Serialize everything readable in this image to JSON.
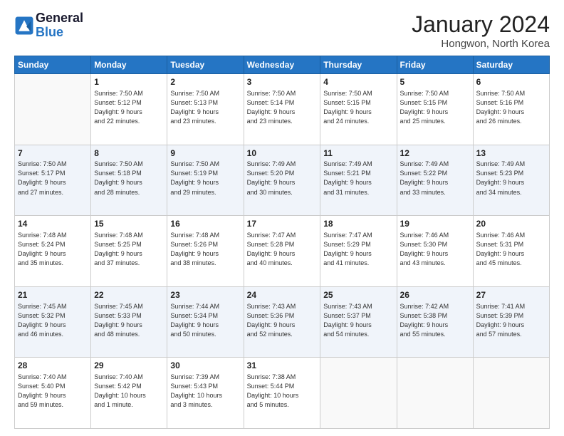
{
  "header": {
    "logo_line1": "General",
    "logo_line2": "Blue",
    "month": "January 2024",
    "location": "Hongwon, North Korea"
  },
  "days_of_week": [
    "Sunday",
    "Monday",
    "Tuesday",
    "Wednesday",
    "Thursday",
    "Friday",
    "Saturday"
  ],
  "weeks": [
    [
      {
        "num": "",
        "info": ""
      },
      {
        "num": "1",
        "info": "Sunrise: 7:50 AM\nSunset: 5:12 PM\nDaylight: 9 hours\nand 22 minutes."
      },
      {
        "num": "2",
        "info": "Sunrise: 7:50 AM\nSunset: 5:13 PM\nDaylight: 9 hours\nand 23 minutes."
      },
      {
        "num": "3",
        "info": "Sunrise: 7:50 AM\nSunset: 5:14 PM\nDaylight: 9 hours\nand 23 minutes."
      },
      {
        "num": "4",
        "info": "Sunrise: 7:50 AM\nSunset: 5:15 PM\nDaylight: 9 hours\nand 24 minutes."
      },
      {
        "num": "5",
        "info": "Sunrise: 7:50 AM\nSunset: 5:15 PM\nDaylight: 9 hours\nand 25 minutes."
      },
      {
        "num": "6",
        "info": "Sunrise: 7:50 AM\nSunset: 5:16 PM\nDaylight: 9 hours\nand 26 minutes."
      }
    ],
    [
      {
        "num": "7",
        "info": "Sunrise: 7:50 AM\nSunset: 5:17 PM\nDaylight: 9 hours\nand 27 minutes."
      },
      {
        "num": "8",
        "info": "Sunrise: 7:50 AM\nSunset: 5:18 PM\nDaylight: 9 hours\nand 28 minutes."
      },
      {
        "num": "9",
        "info": "Sunrise: 7:50 AM\nSunset: 5:19 PM\nDaylight: 9 hours\nand 29 minutes."
      },
      {
        "num": "10",
        "info": "Sunrise: 7:49 AM\nSunset: 5:20 PM\nDaylight: 9 hours\nand 30 minutes."
      },
      {
        "num": "11",
        "info": "Sunrise: 7:49 AM\nSunset: 5:21 PM\nDaylight: 9 hours\nand 31 minutes."
      },
      {
        "num": "12",
        "info": "Sunrise: 7:49 AM\nSunset: 5:22 PM\nDaylight: 9 hours\nand 33 minutes."
      },
      {
        "num": "13",
        "info": "Sunrise: 7:49 AM\nSunset: 5:23 PM\nDaylight: 9 hours\nand 34 minutes."
      }
    ],
    [
      {
        "num": "14",
        "info": "Sunrise: 7:48 AM\nSunset: 5:24 PM\nDaylight: 9 hours\nand 35 minutes."
      },
      {
        "num": "15",
        "info": "Sunrise: 7:48 AM\nSunset: 5:25 PM\nDaylight: 9 hours\nand 37 minutes."
      },
      {
        "num": "16",
        "info": "Sunrise: 7:48 AM\nSunset: 5:26 PM\nDaylight: 9 hours\nand 38 minutes."
      },
      {
        "num": "17",
        "info": "Sunrise: 7:47 AM\nSunset: 5:28 PM\nDaylight: 9 hours\nand 40 minutes."
      },
      {
        "num": "18",
        "info": "Sunrise: 7:47 AM\nSunset: 5:29 PM\nDaylight: 9 hours\nand 41 minutes."
      },
      {
        "num": "19",
        "info": "Sunrise: 7:46 AM\nSunset: 5:30 PM\nDaylight: 9 hours\nand 43 minutes."
      },
      {
        "num": "20",
        "info": "Sunrise: 7:46 AM\nSunset: 5:31 PM\nDaylight: 9 hours\nand 45 minutes."
      }
    ],
    [
      {
        "num": "21",
        "info": "Sunrise: 7:45 AM\nSunset: 5:32 PM\nDaylight: 9 hours\nand 46 minutes."
      },
      {
        "num": "22",
        "info": "Sunrise: 7:45 AM\nSunset: 5:33 PM\nDaylight: 9 hours\nand 48 minutes."
      },
      {
        "num": "23",
        "info": "Sunrise: 7:44 AM\nSunset: 5:34 PM\nDaylight: 9 hours\nand 50 minutes."
      },
      {
        "num": "24",
        "info": "Sunrise: 7:43 AM\nSunset: 5:36 PM\nDaylight: 9 hours\nand 52 minutes."
      },
      {
        "num": "25",
        "info": "Sunrise: 7:43 AM\nSunset: 5:37 PM\nDaylight: 9 hours\nand 54 minutes."
      },
      {
        "num": "26",
        "info": "Sunrise: 7:42 AM\nSunset: 5:38 PM\nDaylight: 9 hours\nand 55 minutes."
      },
      {
        "num": "27",
        "info": "Sunrise: 7:41 AM\nSunset: 5:39 PM\nDaylight: 9 hours\nand 57 minutes."
      }
    ],
    [
      {
        "num": "28",
        "info": "Sunrise: 7:40 AM\nSunset: 5:40 PM\nDaylight: 9 hours\nand 59 minutes."
      },
      {
        "num": "29",
        "info": "Sunrise: 7:40 AM\nSunset: 5:42 PM\nDaylight: 10 hours\nand 1 minute."
      },
      {
        "num": "30",
        "info": "Sunrise: 7:39 AM\nSunset: 5:43 PM\nDaylight: 10 hours\nand 3 minutes."
      },
      {
        "num": "31",
        "info": "Sunrise: 7:38 AM\nSunset: 5:44 PM\nDaylight: 10 hours\nand 5 minutes."
      },
      {
        "num": "",
        "info": ""
      },
      {
        "num": "",
        "info": ""
      },
      {
        "num": "",
        "info": ""
      }
    ]
  ]
}
